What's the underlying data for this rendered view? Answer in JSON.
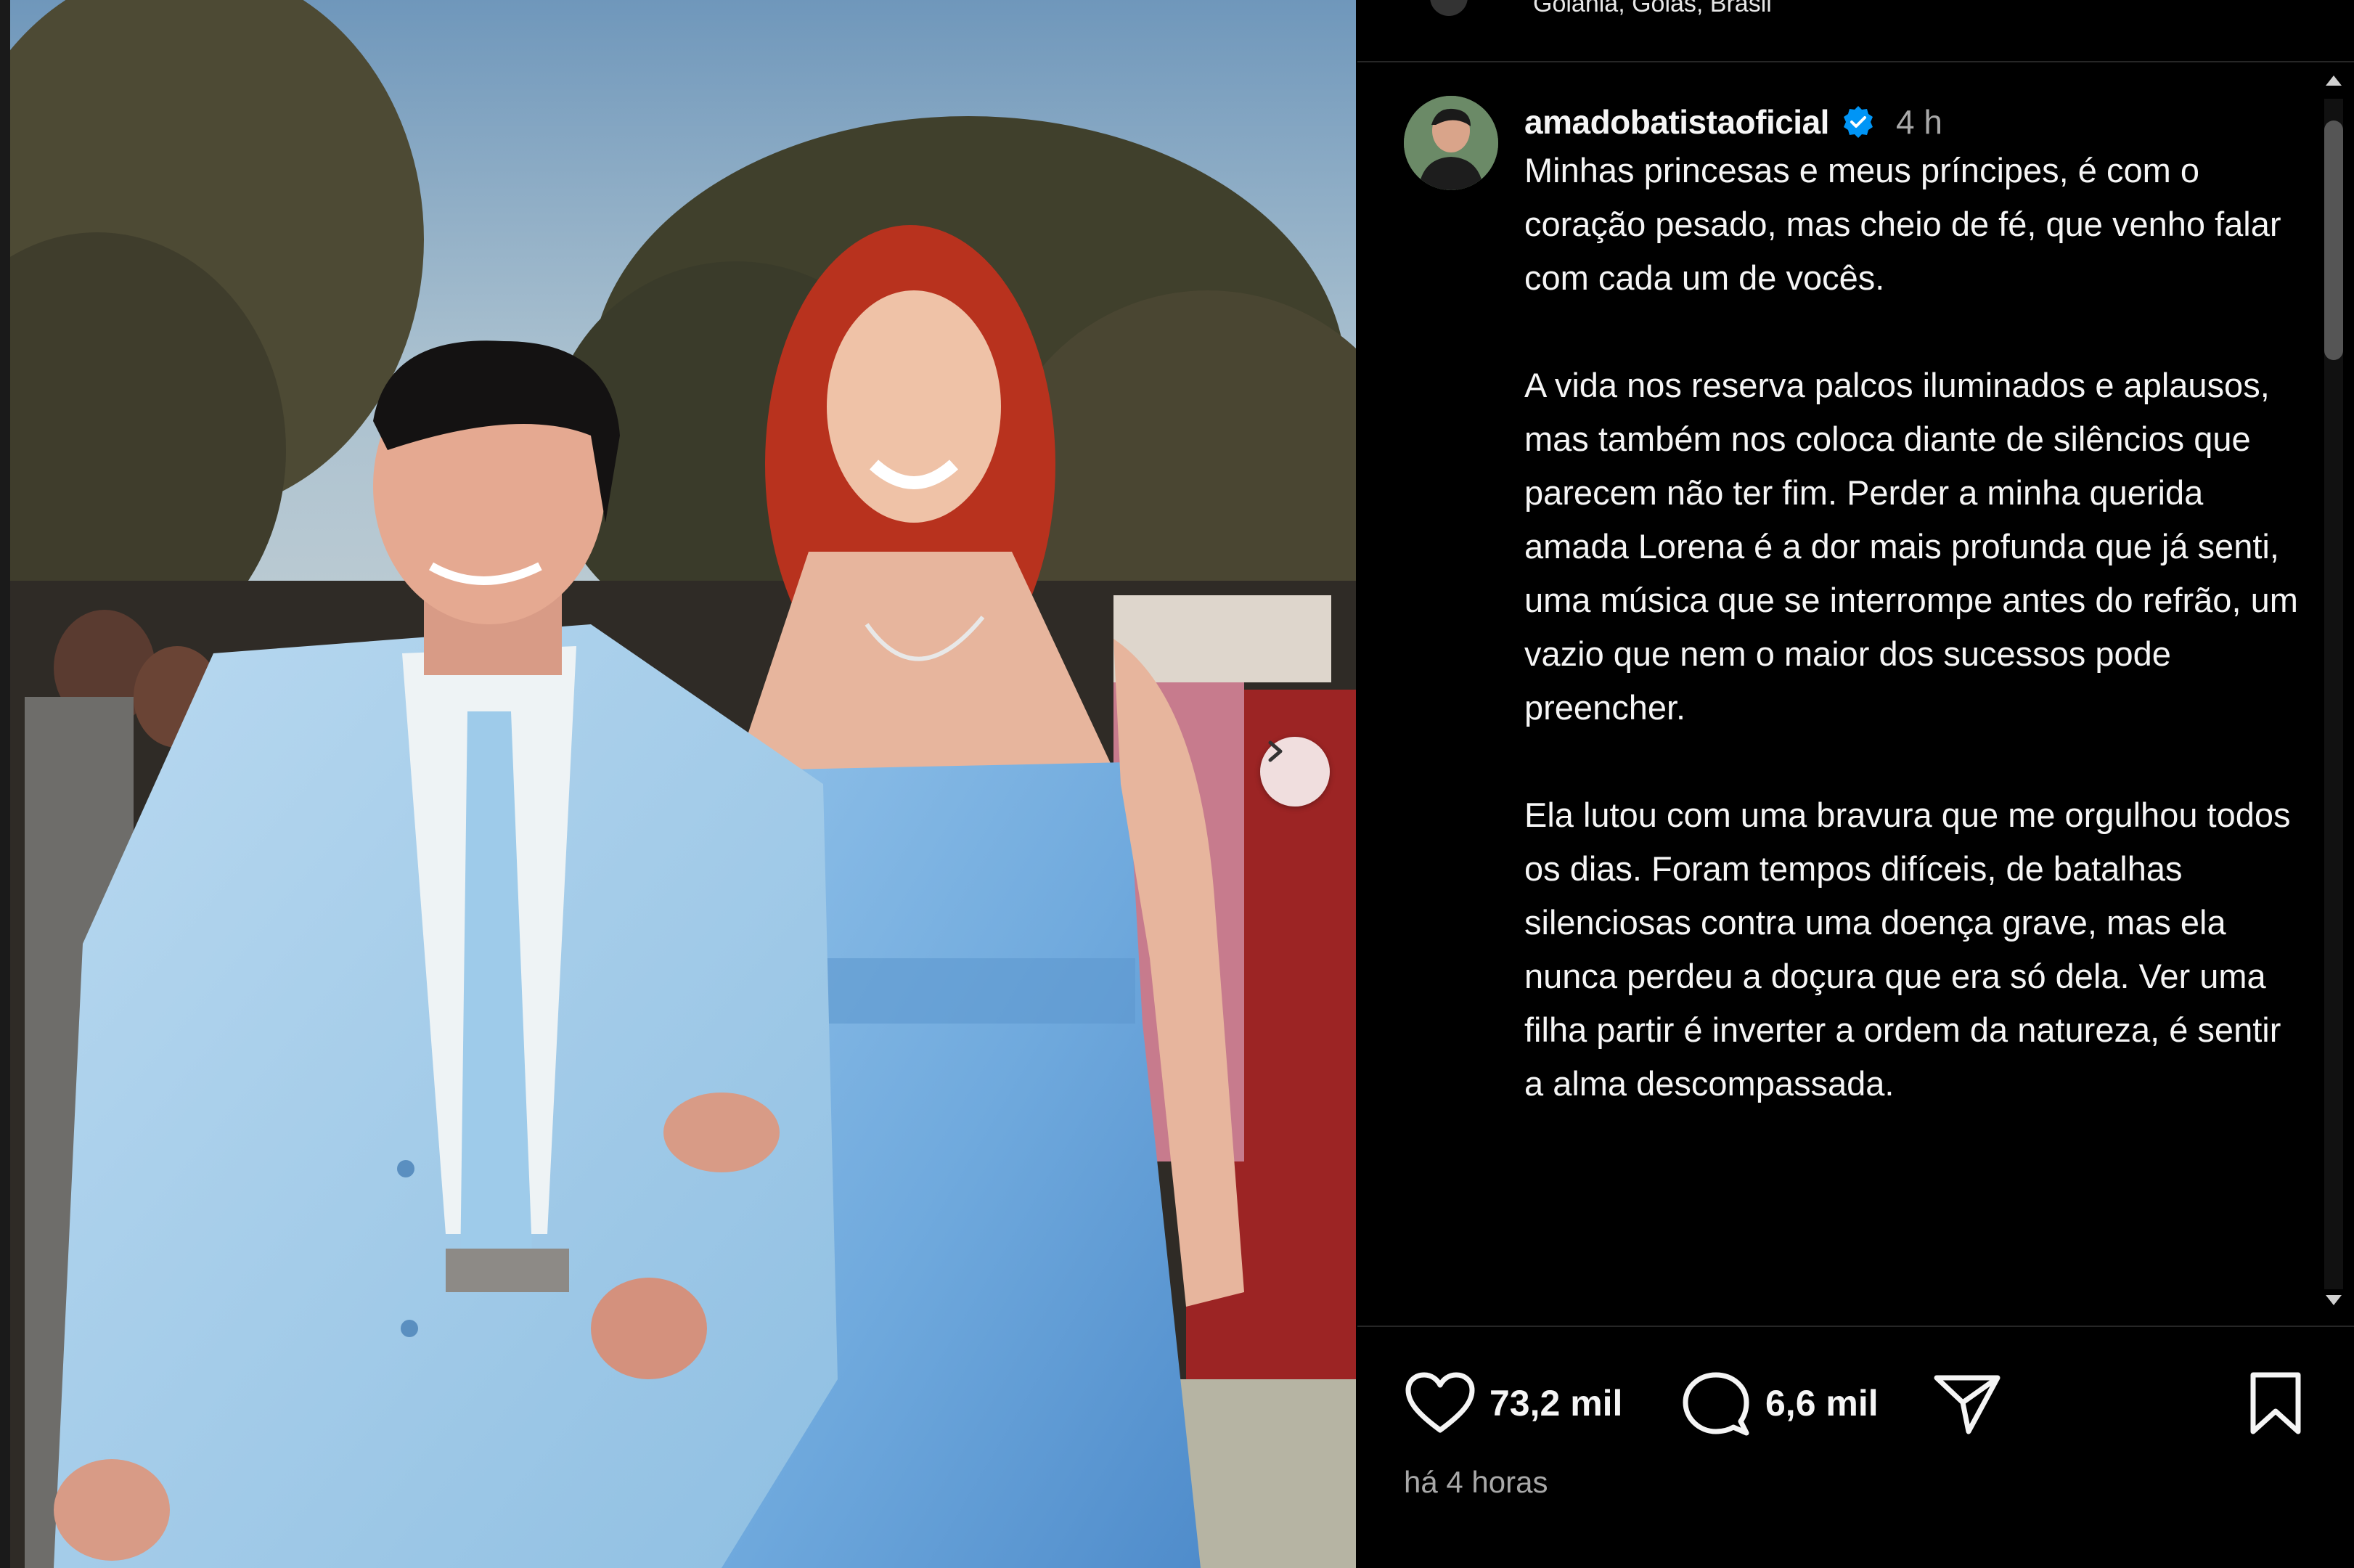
{
  "location": {
    "text": "Goiânia, Goiás, Brasil"
  },
  "post": {
    "username": "amadobatistaoficial",
    "verified": true,
    "time_ago": "4 h",
    "caption_paragraphs": [
      "Minhas princesas e meus príncipes, é com o coração pesado, mas cheio de fé, que venho falar com cada um de vocês.",
      "A vida nos reserva palcos iluminados e aplausos, mas também nos coloca diante de silêncios que parecem não ter fim. Perder a minha querida amada Lorena é a dor mais profunda que já senti, uma música que se interrompe antes do refrão, um vazio que nem o maior dos sucessos pode preencher.",
      "Ela lutou com uma bravura que me orgulhou todos os dias. Foram tempos difíceis, de batalhas silenciosas contra uma doença grave, mas ela nunca perdeu a doçura que era só dela. Ver uma filha partir é inverter a ordem da natureza, é sentir a alma descompassada."
    ]
  },
  "actions": {
    "likes": "73,2 mil",
    "comments": "6,6 mil"
  },
  "footer": {
    "timestamp": "há 4 horas"
  },
  "icons": {
    "like": "heart-icon",
    "comment": "comment-bubble-icon",
    "share": "paper-plane-icon",
    "save": "bookmark-icon",
    "next": "chevron-right-icon",
    "verified": "verified-badge-icon"
  },
  "colors": {
    "background": "#000000",
    "text": "#f5f5f5",
    "muted": "#a8a8a8",
    "verified": "#0095f6"
  }
}
